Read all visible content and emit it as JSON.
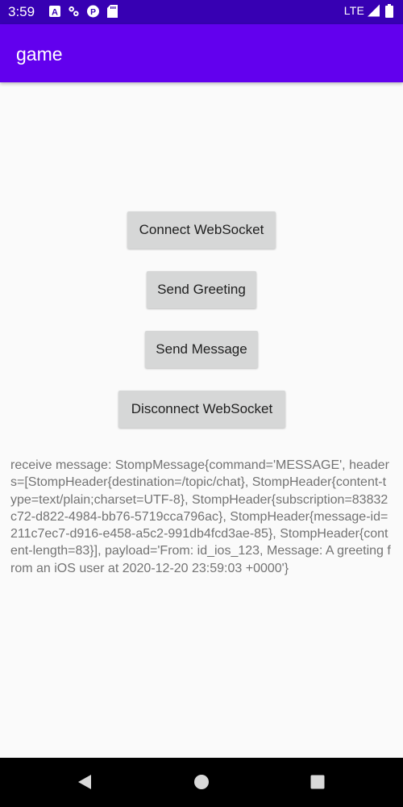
{
  "status_bar": {
    "time": "3:59",
    "network": "LTE",
    "icons": [
      "font-a-icon",
      "gear-icon",
      "circle-p-icon",
      "sd-card-icon",
      "signal-icon",
      "battery-icon"
    ]
  },
  "app_bar": {
    "title": "game",
    "color": "#6200ee",
    "status_color": "#3700b3"
  },
  "buttons": {
    "connect": "Connect WebSocket",
    "greeting": "Send Greeting",
    "message": "Send Message",
    "disconnect": "Disconnect WebSocket"
  },
  "log": {
    "text": "receive message: StompMessage{command='MESSAGE', headers=[StompHeader{destination=/topic/chat}, StompHeader{content-type=text/plain;charset=UTF-8}, StompHeader{subscription=83832c72-d822-4984-bb76-5719cca796ac}, StompHeader{message-id=211c7ec7-d916-e458-a5c2-991db4fcd3ae-85}, StompHeader{content-length=83}], payload='From: id_ios_123, Message: A greeting from an iOS user at 2020-12-20 23:59:03 +0000'}"
  },
  "nav_bar": {
    "icons": [
      "back-icon",
      "home-icon",
      "recents-icon"
    ]
  }
}
